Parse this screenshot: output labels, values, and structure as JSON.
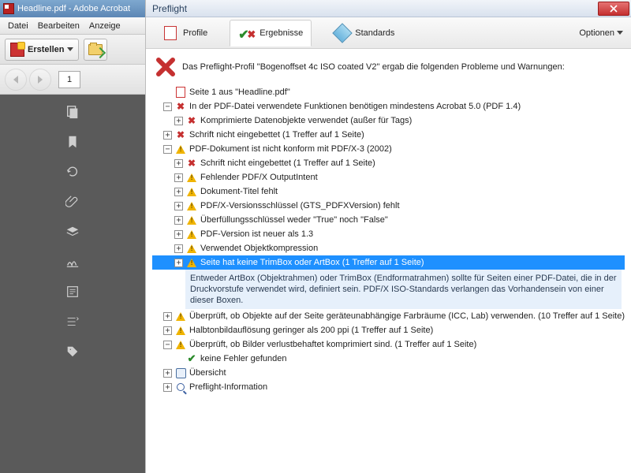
{
  "window": {
    "title": "Headline.pdf - Adobe Acrobat"
  },
  "menubar": {
    "datei": "Datei",
    "bearbeiten": "Bearbeiten",
    "anzeige": "Anzeige"
  },
  "toolbar": {
    "erstellen": "Erstellen",
    "page": "1"
  },
  "preflight": {
    "title": "Preflight",
    "tabs": {
      "profile": "Profile",
      "ergebnisse": "Ergebnisse",
      "standards": "Standards"
    },
    "options": "Optionen",
    "summary": "Das Preflight-Profil \"Bogenoffset 4c ISO coated V2\" ergab die folgenden Probleme und Warnungen:"
  },
  "tree": {
    "n0": "Seite 1 aus \"Headline.pdf\"",
    "n1": "In der PDF-Datei verwendete Funktionen benötigen mindestens Acrobat 5.0 (PDF 1.4)",
    "n1a": "Komprimierte Datenobjekte verwendet (außer für Tags)",
    "n2": "Schrift nicht eingebettet (1 Treffer auf 1 Seite)",
    "n3": "PDF-Dokument ist nicht konform mit PDF/X-3 (2002)",
    "n3a": "Schrift nicht eingebettet (1 Treffer auf 1 Seite)",
    "n3b": "Fehlender PDF/X OutputIntent",
    "n3c": "Dokument-Titel fehlt",
    "n3d": "PDF/X-Versionsschlüssel (GTS_PDFXVersion) fehlt",
    "n3e": "Überfüllungsschlüssel weder \"True\" noch \"False\"",
    "n3f": "PDF-Version ist neuer als 1.3",
    "n3g": "Verwendet Objektkompression",
    "n3h": "Seite hat keine TrimBox oder ArtBox (1 Treffer auf 1 Seite)",
    "n3h_desc": "Entweder ArtBox (Objektrahmen) oder TrimBox (Endformatrahmen) sollte für Seiten einer PDF-Datei, die in der Druckvorstufe verwendet wird, definiert sein. PDF/X ISO-Standards verlangen das Vorhandensein von einer dieser Boxen.",
    "n4": "Überprüft, ob Objekte auf der Seite geräteunabhängige Farbräume (ICC, Lab) verwenden. (10 Treffer auf 1 Seite)",
    "n5": "Halbtonbildauflösung geringer als 200 ppi (1 Treffer auf 1 Seite)",
    "n6": "Überprüft, ob Bilder verlustbehaftet komprimiert sind. (1 Treffer auf 1 Seite)",
    "n7": "keine Fehler gefunden",
    "n8": "Übersicht",
    "n9": "Preflight-Information"
  }
}
